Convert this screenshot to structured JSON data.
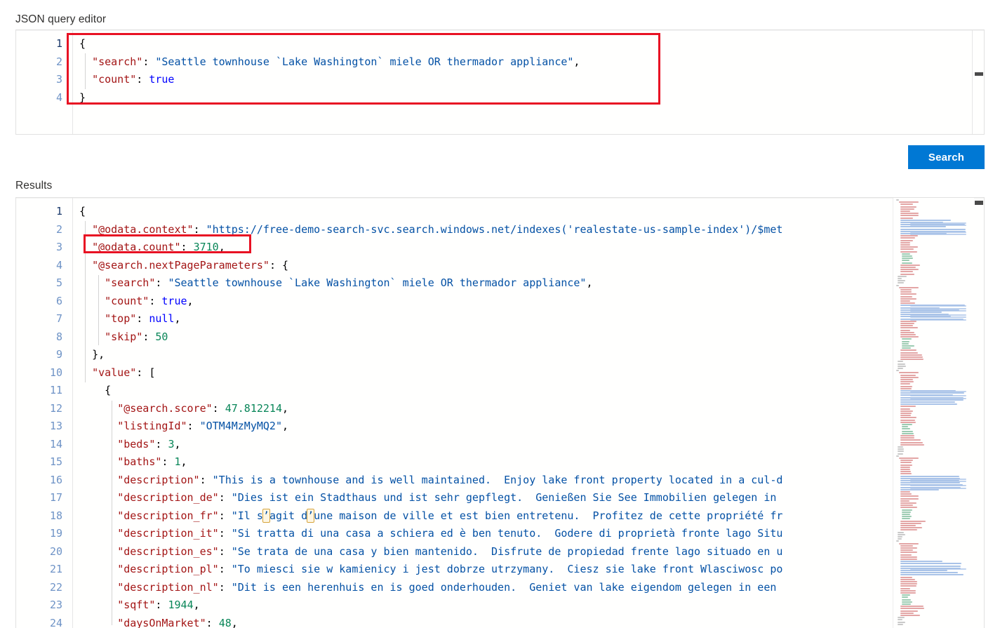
{
  "labels": {
    "query_editor": "JSON query editor",
    "results": "Results"
  },
  "toolbar": {
    "search_label": "Search"
  },
  "colors": {
    "accent": "#0078d4",
    "annotation": "#e81123",
    "key": "#a31515",
    "string": "#0451a5",
    "number": "#098658",
    "boolean": "#0000ff"
  },
  "query_editor": {
    "line_numbers": [
      "1",
      "2",
      "3",
      "4"
    ],
    "lines": [
      [
        {
          "t": "brace",
          "v": "{"
        }
      ],
      [
        {
          "t": "punc",
          "v": "  "
        },
        {
          "t": "key",
          "v": "\"search\""
        },
        {
          "t": "punc",
          "v": ": "
        },
        {
          "t": "str",
          "v": "\"Seattle townhouse `Lake Washington` miele OR thermador appliance\""
        },
        {
          "t": "punc",
          "v": ","
        }
      ],
      [
        {
          "t": "punc",
          "v": "  "
        },
        {
          "t": "key",
          "v": "\"count\""
        },
        {
          "t": "punc",
          "v": ": "
        },
        {
          "t": "bool",
          "v": "true"
        }
      ],
      [
        {
          "t": "brace",
          "v": "}"
        }
      ]
    ]
  },
  "results_editor": {
    "line_numbers": [
      "1",
      "2",
      "3",
      "4",
      "5",
      "6",
      "7",
      "8",
      "9",
      "10",
      "11",
      "12",
      "13",
      "14",
      "15",
      "16",
      "17",
      "18",
      "19",
      "20",
      "21",
      "22",
      "23",
      "24"
    ],
    "lines": [
      [
        {
          "t": "brace",
          "v": "{"
        }
      ],
      [
        {
          "t": "punc",
          "v": "  "
        },
        {
          "t": "key",
          "v": "\"@odata.context\""
        },
        {
          "t": "punc",
          "v": ": "
        },
        {
          "t": "str",
          "v": "\"https://free-demo-search-svc.search.windows.net/indexes('realestate-us-sample-index')/$met"
        }
      ],
      [
        {
          "t": "punc",
          "v": "  "
        },
        {
          "t": "key",
          "v": "\"@odata.count\""
        },
        {
          "t": "punc",
          "v": ": "
        },
        {
          "t": "num",
          "v": "3710"
        },
        {
          "t": "punc",
          "v": ","
        }
      ],
      [
        {
          "t": "punc",
          "v": "  "
        },
        {
          "t": "key",
          "v": "\"@search.nextPageParameters\""
        },
        {
          "t": "punc",
          "v": ": "
        },
        {
          "t": "brace",
          "v": "{"
        }
      ],
      [
        {
          "t": "punc",
          "v": "    "
        },
        {
          "t": "key",
          "v": "\"search\""
        },
        {
          "t": "punc",
          "v": ": "
        },
        {
          "t": "str",
          "v": "\"Seattle townhouse `Lake Washington` miele OR thermador appliance\""
        },
        {
          "t": "punc",
          "v": ","
        }
      ],
      [
        {
          "t": "punc",
          "v": "    "
        },
        {
          "t": "key",
          "v": "\"count\""
        },
        {
          "t": "punc",
          "v": ": "
        },
        {
          "t": "bool",
          "v": "true"
        },
        {
          "t": "punc",
          "v": ","
        }
      ],
      [
        {
          "t": "punc",
          "v": "    "
        },
        {
          "t": "key",
          "v": "\"top\""
        },
        {
          "t": "punc",
          "v": ": "
        },
        {
          "t": "null",
          "v": "null"
        },
        {
          "t": "punc",
          "v": ","
        }
      ],
      [
        {
          "t": "punc",
          "v": "    "
        },
        {
          "t": "key",
          "v": "\"skip\""
        },
        {
          "t": "punc",
          "v": ": "
        },
        {
          "t": "num",
          "v": "50"
        }
      ],
      [
        {
          "t": "punc",
          "v": "  "
        },
        {
          "t": "brace",
          "v": "}"
        },
        {
          "t": "punc",
          "v": ","
        }
      ],
      [
        {
          "t": "punc",
          "v": "  "
        },
        {
          "t": "key",
          "v": "\"value\""
        },
        {
          "t": "punc",
          "v": ": "
        },
        {
          "t": "brace",
          "v": "["
        }
      ],
      [
        {
          "t": "punc",
          "v": "    "
        },
        {
          "t": "brace",
          "v": "{"
        }
      ],
      [
        {
          "t": "punc",
          "v": "      "
        },
        {
          "t": "key",
          "v": "\"@search.score\""
        },
        {
          "t": "punc",
          "v": ": "
        },
        {
          "t": "num",
          "v": "47.812214"
        },
        {
          "t": "punc",
          "v": ","
        }
      ],
      [
        {
          "t": "punc",
          "v": "      "
        },
        {
          "t": "key",
          "v": "\"listingId\""
        },
        {
          "t": "punc",
          "v": ": "
        },
        {
          "t": "str",
          "v": "\"OTM4MzMyMQ2\""
        },
        {
          "t": "punc",
          "v": ","
        }
      ],
      [
        {
          "t": "punc",
          "v": "      "
        },
        {
          "t": "key",
          "v": "\"beds\""
        },
        {
          "t": "punc",
          "v": ": "
        },
        {
          "t": "num",
          "v": "3"
        },
        {
          "t": "punc",
          "v": ","
        }
      ],
      [
        {
          "t": "punc",
          "v": "      "
        },
        {
          "t": "key",
          "v": "\"baths\""
        },
        {
          "t": "punc",
          "v": ": "
        },
        {
          "t": "num",
          "v": "1"
        },
        {
          "t": "punc",
          "v": ","
        }
      ],
      [
        {
          "t": "punc",
          "v": "      "
        },
        {
          "t": "key",
          "v": "\"description\""
        },
        {
          "t": "punc",
          "v": ": "
        },
        {
          "t": "str",
          "v": "\"This is a townhouse and is well maintained.  Enjoy lake front property located in a cul-d"
        }
      ],
      [
        {
          "t": "punc",
          "v": "      "
        },
        {
          "t": "key",
          "v": "\"description_de\""
        },
        {
          "t": "punc",
          "v": ": "
        },
        {
          "t": "str",
          "v": "\"Dies ist ein Stadthaus und ist sehr gepflegt.  Genießen Sie See Immobilien gelegen in "
        }
      ],
      [
        {
          "t": "punc",
          "v": "      "
        },
        {
          "t": "key",
          "v": "\"description_fr\""
        },
        {
          "t": "punc",
          "v": ": "
        },
        {
          "t": "str",
          "v": "\"Il s"
        },
        {
          "t": "odd",
          "v": "’"
        },
        {
          "t": "str",
          "v": "agit d"
        },
        {
          "t": "odd",
          "v": "’"
        },
        {
          "t": "str",
          "v": "une maison de ville et est bien entretenu.  Profitez de cette propriété fr"
        }
      ],
      [
        {
          "t": "punc",
          "v": "      "
        },
        {
          "t": "key",
          "v": "\"description_it\""
        },
        {
          "t": "punc",
          "v": ": "
        },
        {
          "t": "str",
          "v": "\"Si tratta di una casa a schiera ed è ben tenuto.  Godere di proprietà fronte lago Situ"
        }
      ],
      [
        {
          "t": "punc",
          "v": "      "
        },
        {
          "t": "key",
          "v": "\"description_es\""
        },
        {
          "t": "punc",
          "v": ": "
        },
        {
          "t": "str",
          "v": "\"Se trata de una casa y bien mantenido.  Disfrute de propiedad frente lago situado en u"
        }
      ],
      [
        {
          "t": "punc",
          "v": "      "
        },
        {
          "t": "key",
          "v": "\"description_pl\""
        },
        {
          "t": "punc",
          "v": ": "
        },
        {
          "t": "str",
          "v": "\"To miesci sie w kamienicy i jest dobrze utrzymany.  Ciesz sie lake front Wlasciwosc po"
        }
      ],
      [
        {
          "t": "punc",
          "v": "      "
        },
        {
          "t": "key",
          "v": "\"description_nl\""
        },
        {
          "t": "punc",
          "v": ": "
        },
        {
          "t": "str",
          "v": "\"Dit is een herenhuis en is goed onderhouden.  Geniet van lake eigendom gelegen in een "
        }
      ],
      [
        {
          "t": "punc",
          "v": "      "
        },
        {
          "t": "key",
          "v": "\"sqft\""
        },
        {
          "t": "punc",
          "v": ": "
        },
        {
          "t": "num",
          "v": "1944"
        },
        {
          "t": "punc",
          "v": ","
        }
      ],
      [
        {
          "t": "punc",
          "v": "      "
        },
        {
          "t": "key",
          "v": "\"daysOnMarket\""
        },
        {
          "t": "punc",
          "v": ": "
        },
        {
          "t": "num",
          "v": "48"
        },
        {
          "t": "punc",
          "v": ","
        }
      ]
    ]
  },
  "annotations": [
    {
      "name": "query-body-highlight",
      "target": "query json object"
    },
    {
      "name": "odata-count-highlight",
      "target": "\"@odata.count\": 3710,"
    }
  ]
}
